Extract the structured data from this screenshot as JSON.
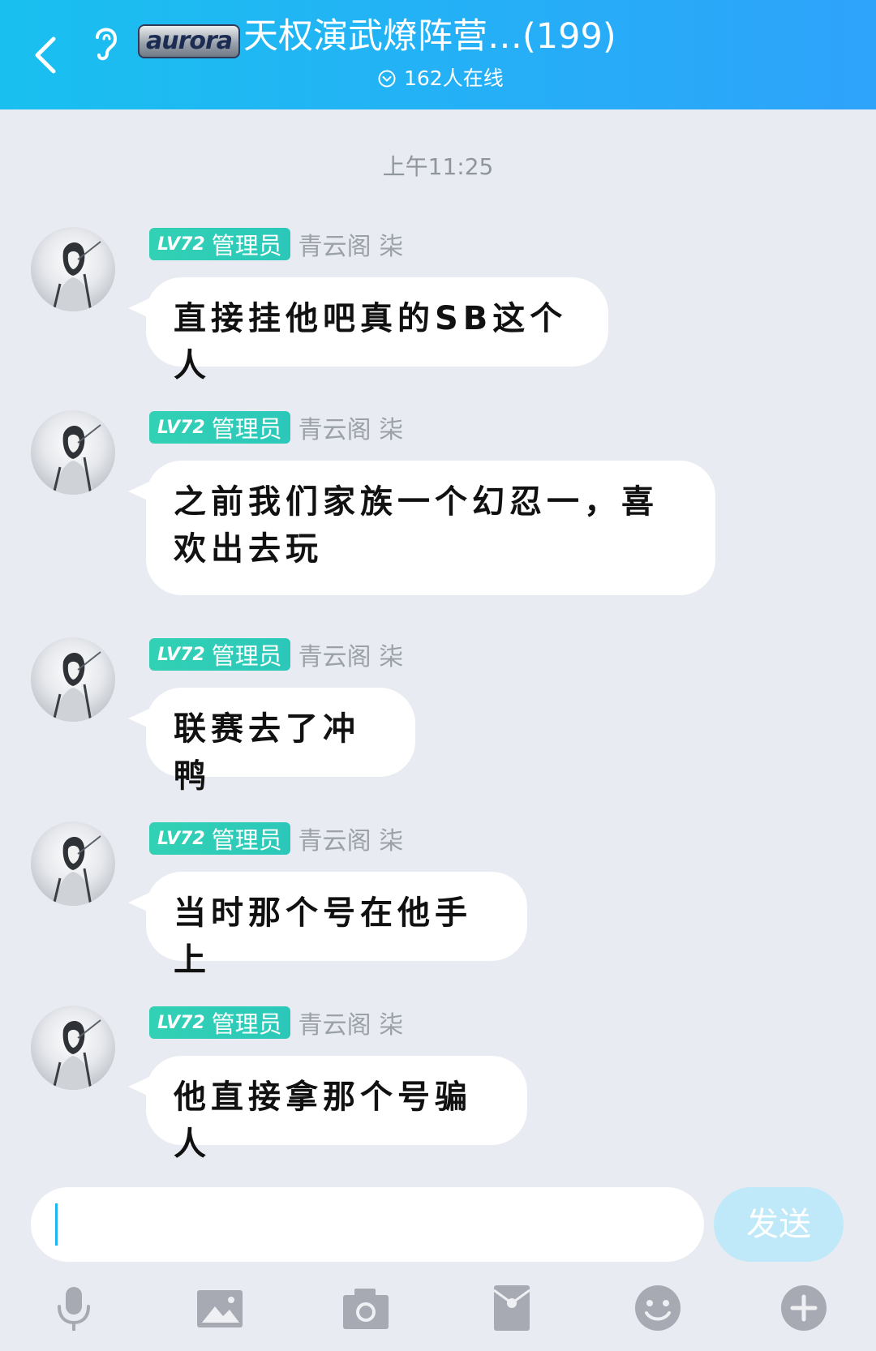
{
  "header": {
    "logo_text": "aurora",
    "title": "天权演武燎阵营…(199)",
    "online": "162人在线",
    "color_start": "#19c0ef",
    "color_end": "#2ea3fa"
  },
  "chat": {
    "time": "上午11:25",
    "messages": [
      {
        "level": "LV72",
        "role": "管理员",
        "sender": "青云阁 柒",
        "text": "直接挂他吧真的SB这个人"
      },
      {
        "level": "LV72",
        "role": "管理员",
        "sender": "青云阁 柒",
        "text": "之前我们家族一个幻忍一，喜欢出去玩"
      },
      {
        "level": "LV72",
        "role": "管理员",
        "sender": "青云阁 柒",
        "text": "联赛去了冲鸭"
      },
      {
        "level": "LV72",
        "role": "管理员",
        "sender": "青云阁 柒",
        "text": "当时那个号在他手上"
      },
      {
        "level": "LV72",
        "role": "管理员",
        "sender": "青云阁 柒",
        "text": "他直接拿那个号骗人"
      }
    ]
  },
  "input": {
    "value": "",
    "send_label": "发送"
  },
  "toolbar": {
    "icons": [
      "microphone-icon",
      "image-icon",
      "camera-icon",
      "red-packet-icon",
      "emoji-icon",
      "plus-icon"
    ]
  }
}
